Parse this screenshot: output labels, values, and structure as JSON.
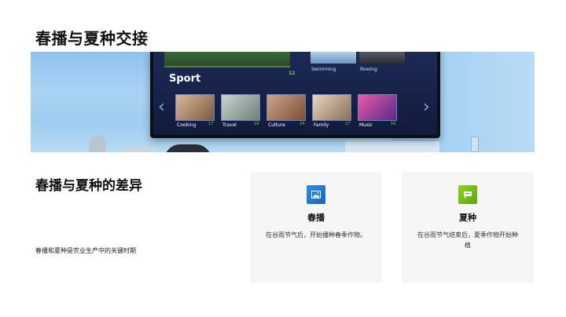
{
  "slide": {
    "title": "春播与夏种交接"
  },
  "hero": {
    "tv": {
      "category": "Sport",
      "feature_badge": "12",
      "top_row": [
        {
          "label": "Swimming"
        },
        {
          "label": "Rowing"
        }
      ],
      "tiles": [
        {
          "label": "Cooking",
          "num": "17"
        },
        {
          "label": "Travel",
          "num": "18"
        },
        {
          "label": "Culture",
          "num": "24"
        },
        {
          "label": "Family",
          "num": "17"
        },
        {
          "label": "Music",
          "num": "16"
        }
      ],
      "prev_icon": "chevron-left-icon",
      "next_icon": "chevron-right-icon"
    }
  },
  "section": {
    "title": "春播与夏种的差异",
    "description": "春播和夏种是农业生产中的关键时期"
  },
  "cards": [
    {
      "icon": "image-icon",
      "title": "春播",
      "text": "在谷雨节气后，开始播种春季作物。",
      "accent": "#1e7bd6"
    },
    {
      "icon": "chat-icon",
      "title": "夏种",
      "text": "在谷雨节气结束后，夏季作物开始种植",
      "accent": "#7cc614"
    }
  ],
  "colors": {
    "background": "#ffffff",
    "card_background": "#f6f6f6"
  }
}
